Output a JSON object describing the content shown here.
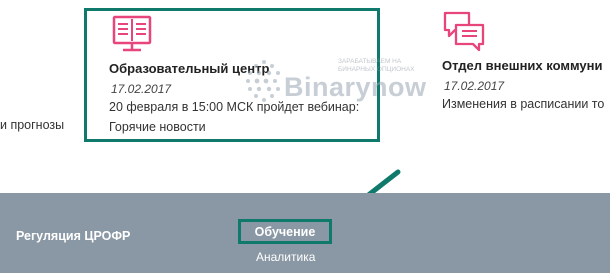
{
  "left_fragment": "и прогнозы",
  "cards": {
    "education": {
      "title": "Образовательный центр",
      "date": "17.02.2017",
      "text_line1": "20 февраля в 15:00 МСК пройдет вебинар:",
      "text_line2": "Горячие новости",
      "icon": "book-monitor-icon"
    },
    "communications": {
      "title": "Отдел внешних коммуни",
      "date": "17.02.2017",
      "text": "Изменения в расписании то",
      "icon": "chat-bubbles-icon"
    }
  },
  "watermark": {
    "brand": "Binarynow",
    "sub_line1": "ЗАРАБАТЫВАЕМ НА",
    "sub_line2": "БИНАРНЫХ ОПЦИОНАХ"
  },
  "footer": {
    "regulation_link": "Регуляция ЦРОФР",
    "active_link": "Обучение",
    "sub_link": "Аналитика"
  },
  "colors": {
    "accent_pink": "#e8467a",
    "highlight_teal": "#0f7a6b",
    "footer_bg": "#8a97a4"
  }
}
